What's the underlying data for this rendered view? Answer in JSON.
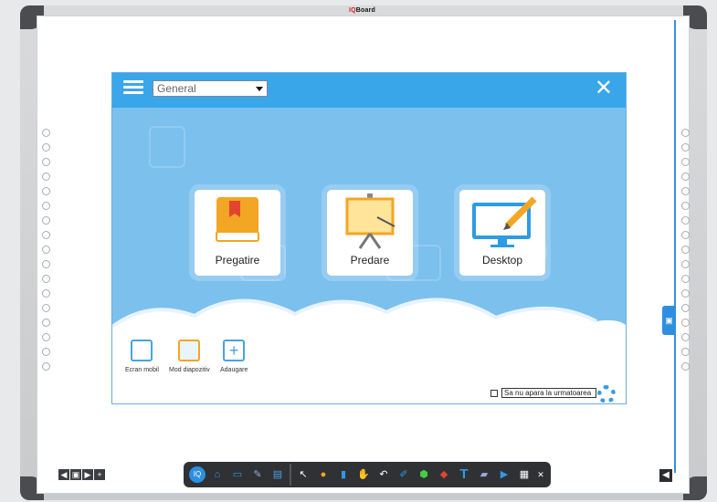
{
  "brand": {
    "prefix": "IQ",
    "name": "Board"
  },
  "dialog": {
    "profile_select": "General",
    "close_glyph": "✕",
    "cards": [
      {
        "label": "Pregatire",
        "icon": "book-icon"
      },
      {
        "label": "Predare",
        "icon": "presentation-board-icon"
      },
      {
        "label": "Desktop",
        "icon": "monitor-pencil-icon"
      }
    ],
    "tiles": [
      {
        "label": "Ecran mobil",
        "icon": "mobile-screen-icon"
      },
      {
        "label": "Mod diapozitiv",
        "icon": "slideshow-icon"
      },
      {
        "label": "Adaugare",
        "icon": "add-icon"
      }
    ],
    "dont_show": "Sa nu apara la urmatoarea"
  },
  "toolbar": {
    "left_nav": [
      "◀",
      "▣",
      "▶",
      "+"
    ],
    "right_nav": "◀",
    "main_tools": [
      "IQ",
      "⌂",
      "▭",
      "✎",
      "▤",
      "↖",
      "●",
      "▮",
      "✋",
      "↶",
      "✐",
      "⬢",
      "◆",
      "T",
      "▰",
      "▶",
      "▦",
      "✕"
    ]
  },
  "colors": {
    "accent": "#3aa6ea",
    "dialog_bg": "#7cc0ee",
    "toolbar": "#2f3135",
    "card_book": "#f2a623",
    "monitor": "#2e9be3"
  }
}
